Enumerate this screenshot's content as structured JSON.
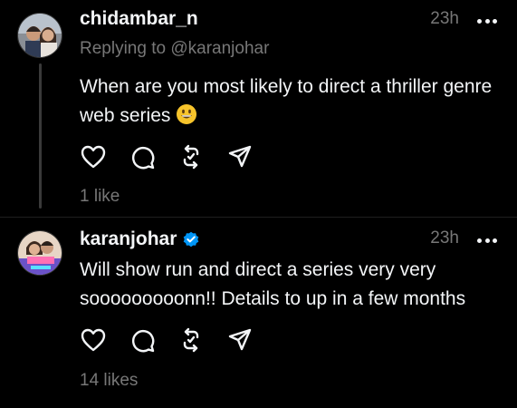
{
  "posts": [
    {
      "username": "chidambar_n",
      "time": "23h",
      "replying_to": "Replying to @karanjohar",
      "text": "When are you most likely to direct a thriller genre web series",
      "emoji": "grinning-face-icon",
      "likes": "1 like",
      "verified": false
    },
    {
      "username": "karanjohar",
      "time": "23h",
      "text": "Will show run and direct a series very very sooooooooonn!! Details to up in a few months",
      "likes": "14 likes",
      "verified": true
    }
  ],
  "colors": {
    "background": "#000000",
    "text": "#f3f5f7",
    "muted": "#777777",
    "verified": "#0095f6",
    "thread_line": "#3a3a3a"
  },
  "icons": [
    "heart-icon",
    "comment-icon",
    "repost-icon",
    "share-icon",
    "more-icon",
    "verified-badge-icon"
  ]
}
